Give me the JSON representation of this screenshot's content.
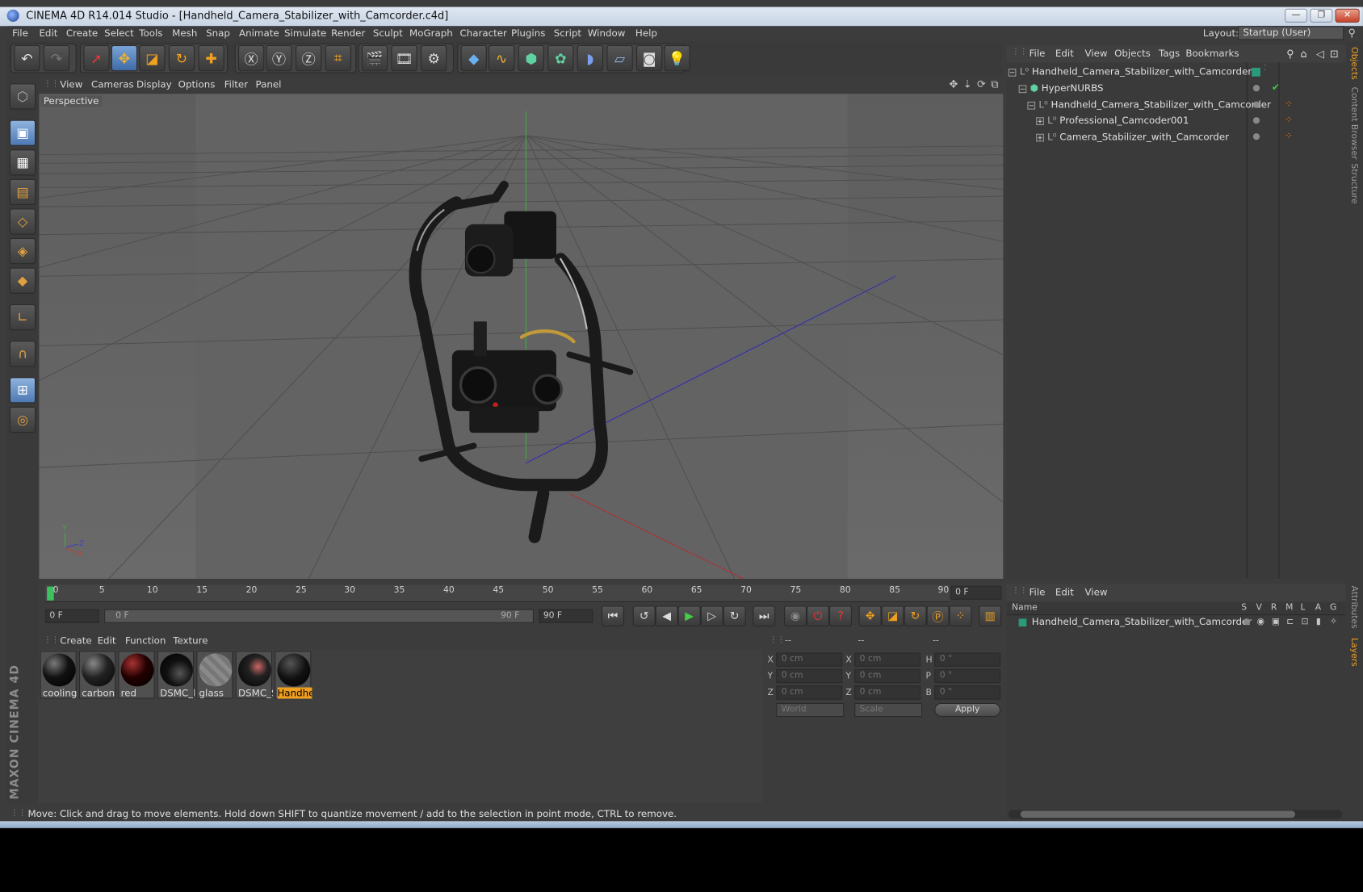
{
  "title": "CINEMA 4D R14.014 Studio - [Handheld_Camera_Stabilizer_with_Camcorder.c4d]",
  "window_controls": {
    "minimize": "—",
    "maximize": "❐",
    "close": "✕"
  },
  "menu": [
    "File",
    "Edit",
    "Create",
    "Select",
    "Tools",
    "Mesh",
    "Snap",
    "Animate",
    "Simulate",
    "Render",
    "Sculpt",
    "MoGraph",
    "Character",
    "Plugins",
    "Script",
    "Window",
    "Help"
  ],
  "layout": {
    "label": "Layout:",
    "value": "Startup (User)"
  },
  "viewport": {
    "menu": [
      "View",
      "Cameras",
      "Display",
      "Options",
      "Filter",
      "Panel"
    ],
    "label": "Perspective",
    "axis_y": "Y",
    "axis_z": "Z",
    "axis_x": "X"
  },
  "timeline": {
    "ticks": [
      "0",
      "5",
      "10",
      "15",
      "20",
      "25",
      "30",
      "35",
      "40",
      "45",
      "50",
      "55",
      "60",
      "65",
      "70",
      "75",
      "80",
      "85",
      "90"
    ],
    "current_frame": "0 F",
    "start_field": "0 F",
    "range_start": "0 F",
    "range_end": "90 F",
    "end_field": "90 F"
  },
  "materials": {
    "menu": [
      "Create",
      "Edit",
      "Function",
      "Texture"
    ],
    "items": [
      "cooling",
      "carbon",
      "red",
      "DSMC_l",
      "glass",
      "DSMC_S",
      "Handhe"
    ]
  },
  "coordinates": {
    "col_headers": [
      "--",
      "--",
      "--"
    ],
    "rows": [
      {
        "a": "X",
        "av": "0 cm",
        "b": "X",
        "bv": "0 cm",
        "c": "H",
        "cv": "0 °"
      },
      {
        "a": "Y",
        "av": "0 cm",
        "b": "Y",
        "bv": "0 cm",
        "c": "P",
        "cv": "0 °"
      },
      {
        "a": "Z",
        "av": "0 cm",
        "b": "Z",
        "bv": "0 cm",
        "c": "B",
        "cv": "0 °"
      }
    ],
    "world": "World",
    "scale": "Scale",
    "apply": "Apply"
  },
  "objects": {
    "menu": [
      "File",
      "Edit",
      "View",
      "Objects",
      "Tags",
      "Bookmarks"
    ],
    "rows": [
      "Handheld_Camera_Stabilizer_with_Camcorder",
      "HyperNURBS",
      "Handheld_Camera_Stabilizer_with_Camcorder",
      "Professional_Camcoder001",
      "Camera_Stabilizer_with_Camcorder"
    ]
  },
  "layers": {
    "menu": [
      "File",
      "Edit",
      "View"
    ],
    "name_header": "Name",
    "flags": [
      "S",
      "V",
      "R",
      "M",
      "L",
      "A",
      "G"
    ],
    "row": "Handheld_Camera_Stabilizer_with_Camcorder"
  },
  "side_tabs": [
    "Objects",
    "Content Browser",
    "Structure",
    "Attributes",
    "Layers"
  ],
  "status": "Move: Click and drag to move elements. Hold down SHIFT to quantize movement / add to the selection in point mode, CTRL to remove.",
  "logo": "MAXON CINEMA 4D",
  "colors": {
    "accent": "#f0a020",
    "selection": "#4d79b3",
    "background": "#3c3c3c"
  }
}
